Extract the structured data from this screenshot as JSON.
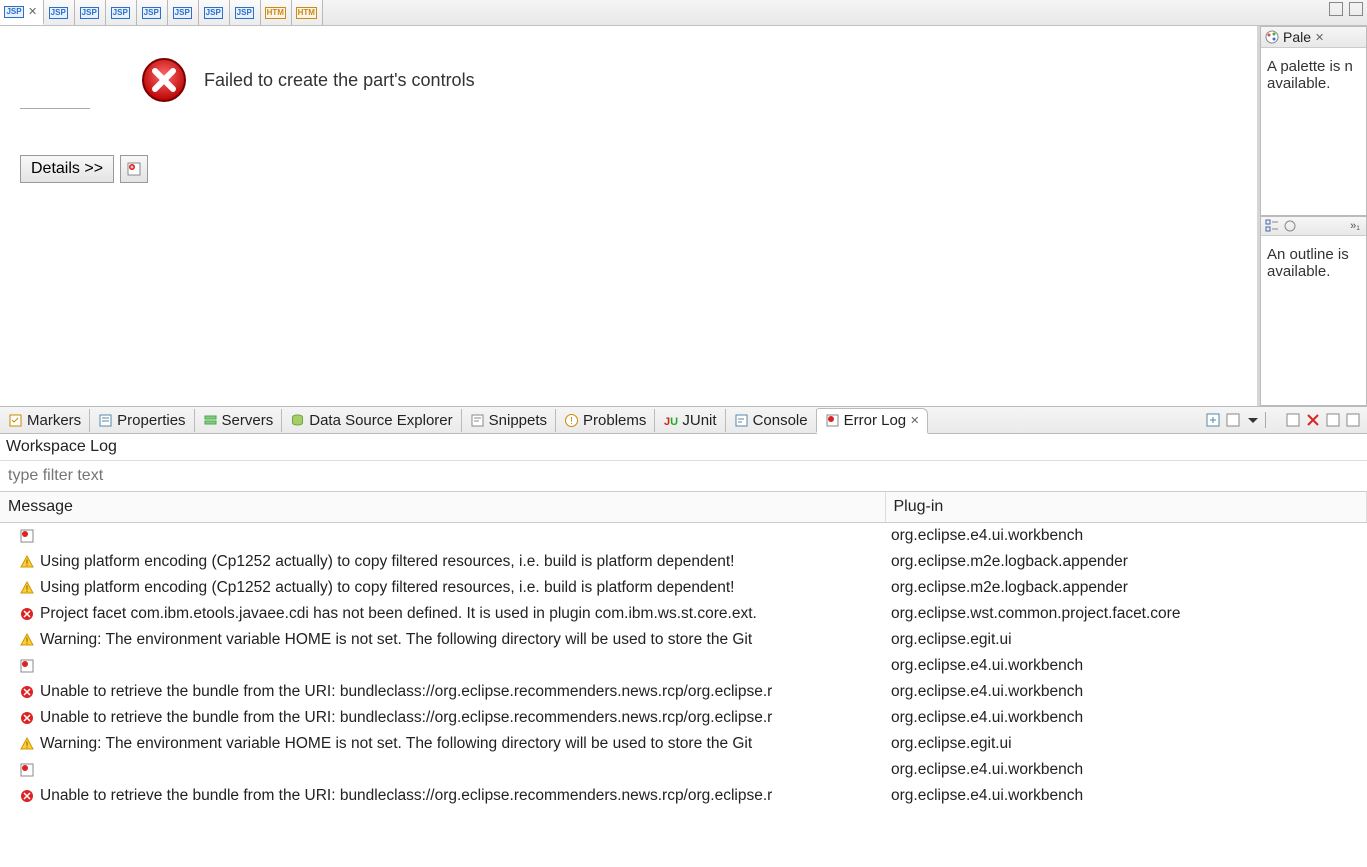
{
  "editor_tabs": [
    {
      "type": "jsp",
      "active": true
    },
    {
      "type": "jsp"
    },
    {
      "type": "jsp"
    },
    {
      "type": "jsp"
    },
    {
      "type": "jsp"
    },
    {
      "type": "jsp"
    },
    {
      "type": "jsp"
    },
    {
      "type": "jsp"
    },
    {
      "type": "htm"
    },
    {
      "type": "htm"
    }
  ],
  "error": {
    "message": "Failed to create the part's controls",
    "details_label": "Details >>"
  },
  "palette": {
    "tab": "Pale",
    "text": "A palette is n available."
  },
  "outline": {
    "text": "An outline is available."
  },
  "views": [
    {
      "label": "Markers",
      "icon": "markers"
    },
    {
      "label": "Properties",
      "icon": "properties"
    },
    {
      "label": "Servers",
      "icon": "servers"
    },
    {
      "label": "Data Source Explorer",
      "icon": "datasource"
    },
    {
      "label": "Snippets",
      "icon": "snippets"
    },
    {
      "label": "Problems",
      "icon": "problems"
    },
    {
      "label": "JUnit",
      "icon": "junit"
    },
    {
      "label": "Console",
      "icon": "console"
    },
    {
      "label": "Error Log",
      "icon": "errorlog",
      "active": true
    }
  ],
  "log": {
    "title": "Workspace Log",
    "filter_placeholder": "type filter text",
    "columns": {
      "message": "Message",
      "plugin": "Plug-in"
    },
    "rows": [
      {
        "sev": "stack",
        "msg": "",
        "plugin": "org.eclipse.e4.ui.workbench"
      },
      {
        "sev": "warn",
        "msg": "Using platform encoding (Cp1252 actually) to copy filtered resources, i.e. build is platform dependent!",
        "plugin": "org.eclipse.m2e.logback.appender"
      },
      {
        "sev": "warn",
        "msg": "Using platform encoding (Cp1252 actually) to copy filtered resources, i.e. build is platform dependent!",
        "plugin": "org.eclipse.m2e.logback.appender"
      },
      {
        "sev": "err",
        "msg": "Project facet com.ibm.etools.javaee.cdi has not been defined. It is used in plugin com.ibm.ws.st.core.ext.",
        "plugin": "org.eclipse.wst.common.project.facet.core"
      },
      {
        "sev": "warn",
        "msg": "Warning: The environment variable HOME is not set. The following directory will be used to store the Git",
        "plugin": "org.eclipse.egit.ui"
      },
      {
        "sev": "stack",
        "msg": "",
        "plugin": "org.eclipse.e4.ui.workbench"
      },
      {
        "sev": "err",
        "msg": "Unable to retrieve the bundle from the URI: bundleclass://org.eclipse.recommenders.news.rcp/org.eclipse.r",
        "plugin": "org.eclipse.e4.ui.workbench"
      },
      {
        "sev": "err",
        "msg": "Unable to retrieve the bundle from the URI: bundleclass://org.eclipse.recommenders.news.rcp/org.eclipse.r",
        "plugin": "org.eclipse.e4.ui.workbench"
      },
      {
        "sev": "warn",
        "msg": "Warning: The environment variable HOME is not set. The following directory will be used to store the Git",
        "plugin": "org.eclipse.egit.ui"
      },
      {
        "sev": "stack",
        "msg": "",
        "plugin": "org.eclipse.e4.ui.workbench"
      },
      {
        "sev": "err",
        "msg": "Unable to retrieve the bundle from the URI: bundleclass://org.eclipse.recommenders.news.rcp/org.eclipse.r",
        "plugin": "org.eclipse.e4.ui.workbench"
      }
    ]
  }
}
